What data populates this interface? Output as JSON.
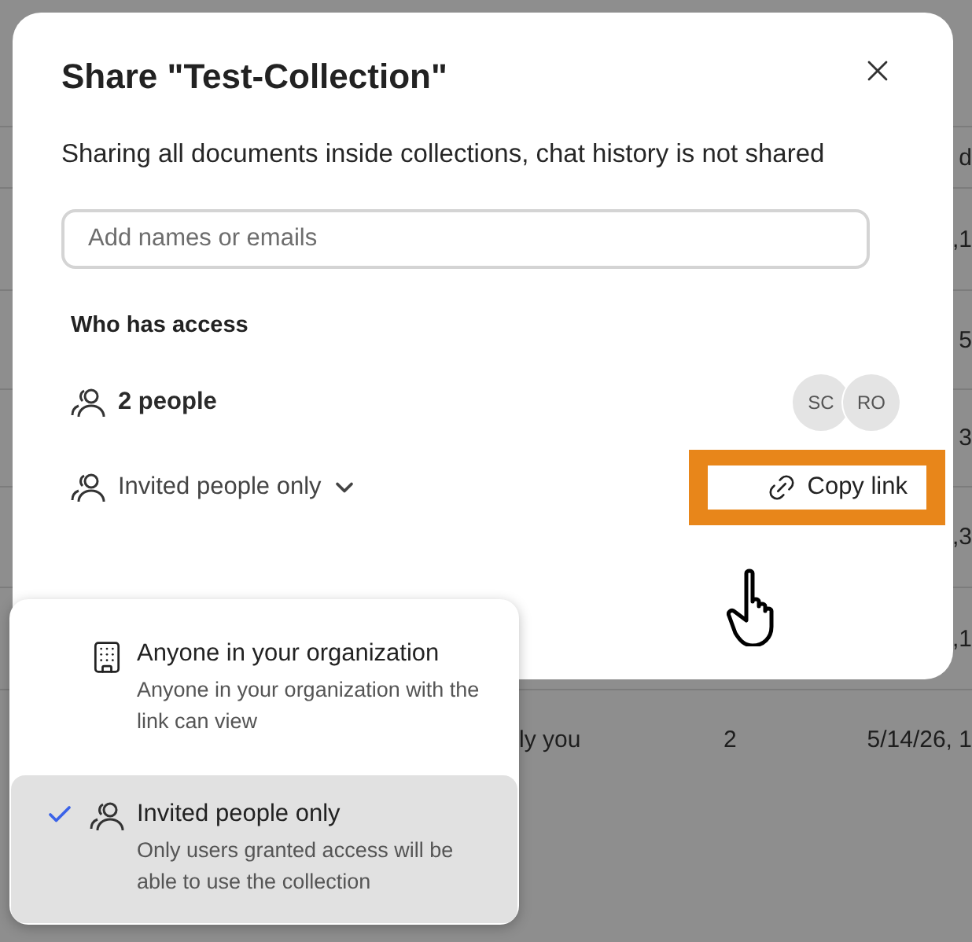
{
  "background_rows": [
    {
      "cells": [
        "d"
      ]
    },
    {
      "cells": [
        ",1"
      ]
    },
    {
      "cells": [
        "5"
      ]
    },
    {
      "cells": [
        "3"
      ]
    },
    {
      "cells": [
        ",3"
      ]
    },
    {
      "cells": [
        ",1"
      ]
    },
    {
      "cells": [
        "ly you",
        "2",
        "5/14/26, 1"
      ]
    }
  ],
  "dialog": {
    "title": "Share \"Test-Collection\"",
    "description": "Sharing all documents inside collections, chat history is not shared",
    "search": {
      "placeholder": "Add names or emails"
    },
    "access_heading": "Who has access",
    "people": {
      "label": "2 people",
      "avatars": [
        "SC",
        "RO"
      ]
    },
    "access_dropdown": {
      "label": "Invited people only",
      "expanded": true
    },
    "copy_link": {
      "label": "Copy link",
      "highlighted": true
    }
  },
  "access_menu": [
    {
      "kind": "organization",
      "title": "Anyone in your organization",
      "description": "Anyone in your organization with the link can view",
      "selected": false
    },
    {
      "kind": "invited",
      "title": "Invited people only",
      "description": "Only users granted access will be able to use the collection",
      "selected": true
    }
  ]
}
